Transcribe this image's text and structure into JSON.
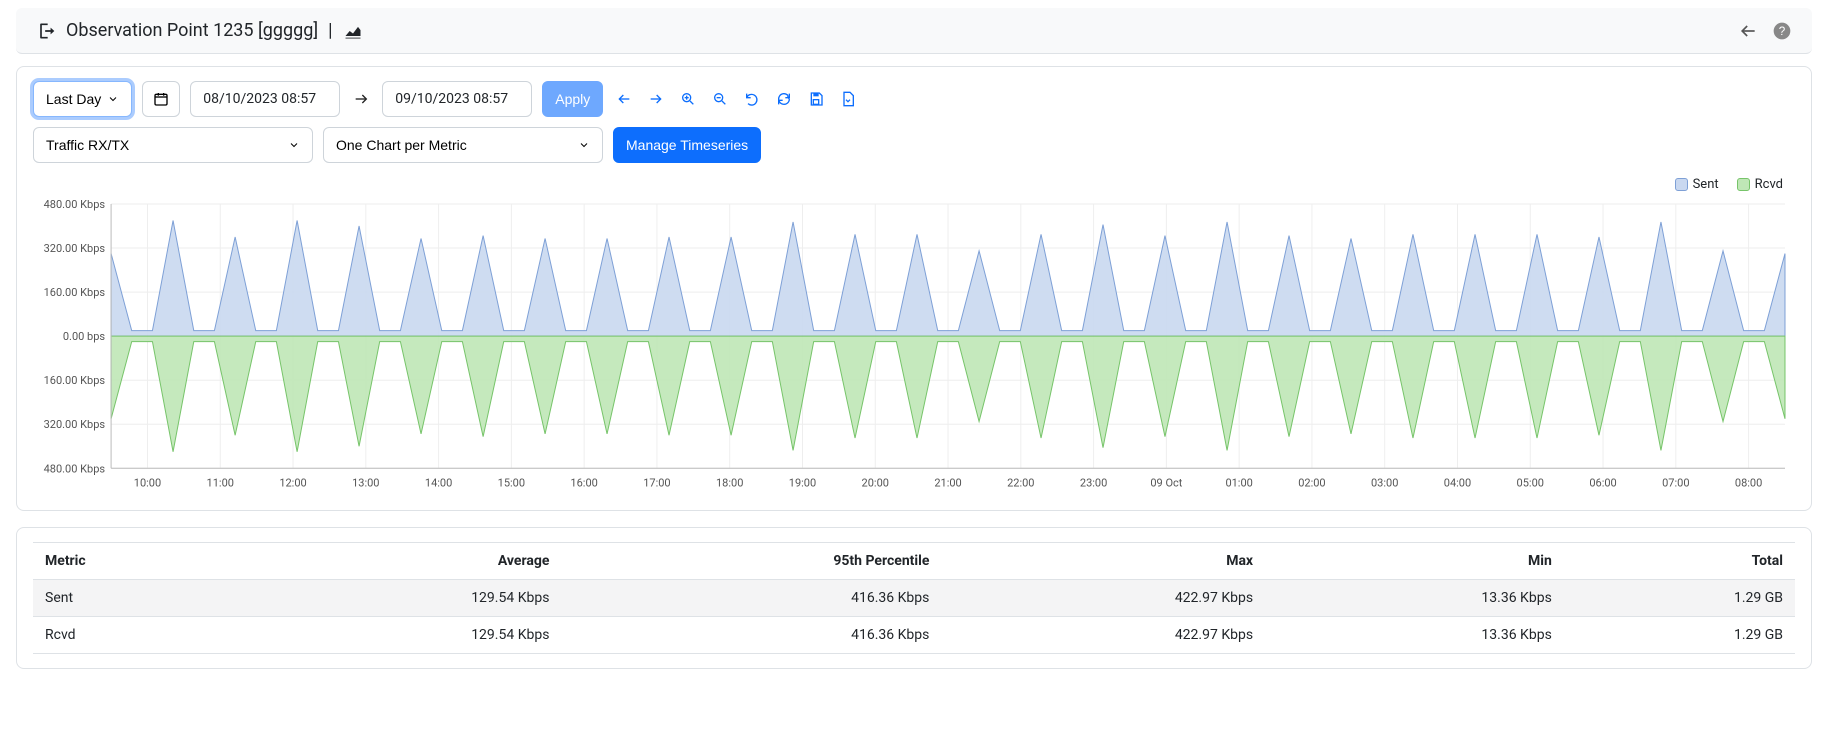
{
  "header": {
    "title": "Observation Point 1235 [ggggg]",
    "separator": "|"
  },
  "toolbar": {
    "range_label": "Last Day",
    "start_time": "08/10/2023 08:57",
    "end_time": "09/10/2023 08:57",
    "apply_label": "Apply",
    "metric_select": "Traffic RX/TX",
    "chart_select": "One Chart per Metric",
    "manage_label": "Manage Timeseries"
  },
  "legend": {
    "sent": "Sent",
    "rcvd": "Rcvd",
    "sent_color": "#c9d8f0",
    "sent_border": "#7ea0d6",
    "rcvd_color": "#bfe7b6",
    "rcvd_border": "#77c46a"
  },
  "table": {
    "headers": [
      "Metric",
      "Average",
      "95th Percentile",
      "Max",
      "Min",
      "Total"
    ],
    "rows": [
      [
        "Sent",
        "129.54 Kbps",
        "416.36 Kbps",
        "422.97 Kbps",
        "13.36 Kbps",
        "1.29 GB"
      ],
      [
        "Rcvd",
        "129.54 Kbps",
        "416.36 Kbps",
        "422.97 Kbps",
        "13.36 Kbps",
        "1.29 GB"
      ]
    ]
  },
  "chart_data": {
    "type": "area",
    "title": "",
    "ylabel": "",
    "xlabel": "",
    "y_ticks_pos": [
      "0.00 bps",
      "160.00 Kbps",
      "320.00 Kbps",
      "480.00 Kbps"
    ],
    "y_ticks_neg": [
      "160.00 Kbps",
      "320.00 Kbps",
      "480.00 Kbps"
    ],
    "ylim_pos": 480,
    "ylim_neg": -480,
    "x_ticks": [
      "10:00",
      "11:00",
      "12:00",
      "13:00",
      "14:00",
      "15:00",
      "16:00",
      "17:00",
      "18:00",
      "19:00",
      "20:00",
      "21:00",
      "22:00",
      "23:00",
      "09 Oct",
      "01:00",
      "02:00",
      "03:00",
      "04:00",
      "05:00",
      "06:00",
      "07:00",
      "08:00"
    ],
    "series": [
      {
        "name": "Sent",
        "color_fill": "#c9d8f0",
        "color_line": "#7ea0d6",
        "direction": "up",
        "values": [
          300,
          20,
          20,
          420,
          20,
          20,
          360,
          20,
          20,
          420,
          20,
          20,
          400,
          20,
          20,
          355,
          20,
          20,
          365,
          20,
          20,
          355,
          20,
          20,
          355,
          20,
          20,
          360,
          20,
          20,
          360,
          20,
          20,
          415,
          20,
          20,
          370,
          20,
          20,
          370,
          20,
          20,
          310,
          20,
          20,
          370,
          20,
          20,
          405,
          20,
          20,
          365,
          20,
          20,
          415,
          20,
          20,
          365,
          20,
          20,
          355,
          20,
          20,
          370,
          20,
          20,
          370,
          20,
          20,
          370,
          20,
          20,
          360,
          20,
          20,
          415,
          20,
          20,
          310,
          20,
          20,
          300
        ]
      },
      {
        "name": "Rcvd",
        "color_fill": "#bfe7b6",
        "color_line": "#77c46a",
        "direction": "down",
        "values": [
          300,
          20,
          20,
          420,
          20,
          20,
          360,
          20,
          20,
          420,
          20,
          20,
          400,
          20,
          20,
          355,
          20,
          20,
          365,
          20,
          20,
          355,
          20,
          20,
          355,
          20,
          20,
          360,
          20,
          20,
          360,
          20,
          20,
          415,
          20,
          20,
          370,
          20,
          20,
          370,
          20,
          20,
          310,
          20,
          20,
          370,
          20,
          20,
          405,
          20,
          20,
          365,
          20,
          20,
          415,
          20,
          20,
          365,
          20,
          20,
          355,
          20,
          20,
          370,
          20,
          20,
          370,
          20,
          20,
          370,
          20,
          20,
          360,
          20,
          20,
          415,
          20,
          20,
          310,
          20,
          20,
          300
        ]
      }
    ]
  }
}
